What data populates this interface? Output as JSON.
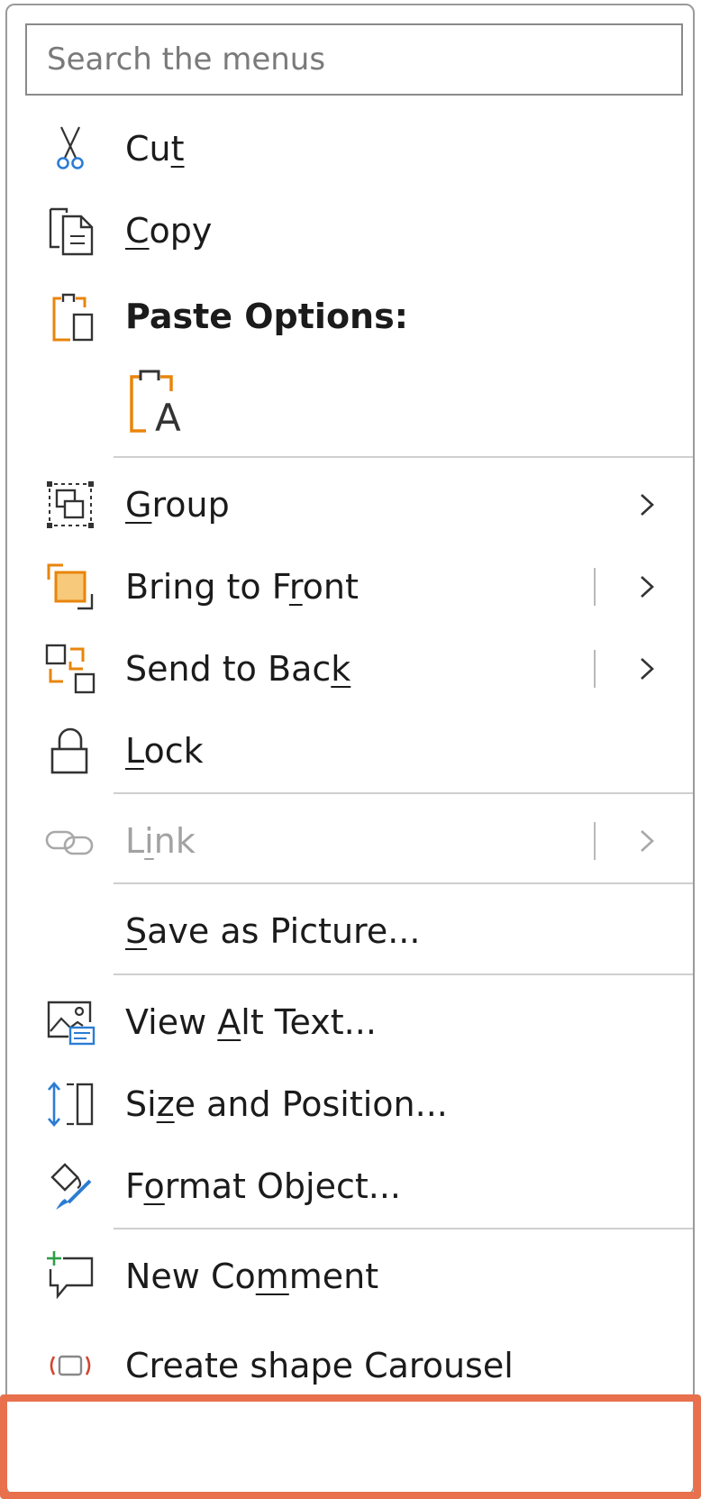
{
  "search": {
    "placeholder": "Search the menus"
  },
  "menu": {
    "items": [
      {
        "name": "cut",
        "pre": "Cu",
        "u": "t",
        "post": "",
        "icon": "scissors-icon"
      },
      {
        "name": "copy",
        "pre": "",
        "u": "C",
        "post": "opy",
        "icon": "copy-icon"
      },
      {
        "name": "paste-options",
        "text": "Paste Options:",
        "icon": "clipboard-icon"
      },
      {
        "name": "group",
        "pre": "",
        "u": "G",
        "post": "roup",
        "icon": "group-icon"
      },
      {
        "name": "bring-to-front",
        "pre": "Bring to F",
        "u": "r",
        "post": "ont",
        "icon": "bring-to-front-icon"
      },
      {
        "name": "send-to-back",
        "pre": "Send to Bac",
        "u": "k",
        "post": "",
        "icon": "send-to-back-icon"
      },
      {
        "name": "lock",
        "pre": "",
        "u": "L",
        "post": "ock",
        "icon": "lock-icon"
      },
      {
        "name": "link",
        "pre": "L",
        "u": "i",
        "post": "nk",
        "icon": "link-icon"
      },
      {
        "name": "save-as-picture",
        "pre": "",
        "u": "S",
        "post": "ave as Picture...",
        "icon": ""
      },
      {
        "name": "view-alt-text",
        "pre": "View ",
        "u": "A",
        "post": "lt Text...",
        "icon": "alt-text-icon"
      },
      {
        "name": "size-and-position",
        "pre": "Si",
        "u": "z",
        "post": "e and Position...",
        "icon": "size-position-icon"
      },
      {
        "name": "format-object",
        "pre": "F",
        "u": "o",
        "post": "rmat Object...",
        "icon": "format-object-icon"
      },
      {
        "name": "new-comment",
        "pre": "New Co",
        "u": "m",
        "post": "ment",
        "icon": "new-comment-icon"
      },
      {
        "name": "create-shape-carousel",
        "text": "Create shape Carousel",
        "icon": "carousel-icon"
      }
    ],
    "paste_option_icon": "paste-keep-text-only-icon"
  },
  "colors": {
    "accent_orange": "#E8850C",
    "accent_blue": "#2B7CD3",
    "comment_green": "#2E9E44",
    "carousel_red": "#D2452E",
    "highlight_border": "#E8704D",
    "disabled_text": "#A2A2A2"
  }
}
